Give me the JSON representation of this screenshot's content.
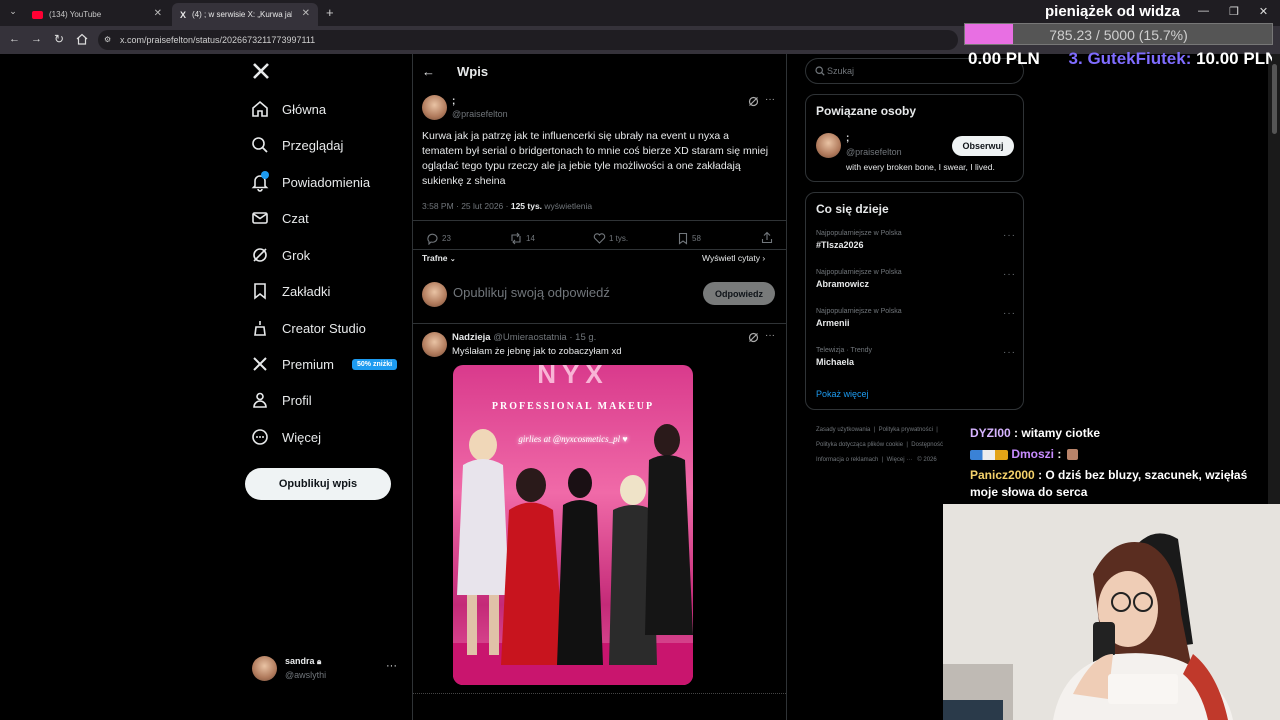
{
  "browser": {
    "tabs": [
      {
        "title": "(134) YouTube"
      },
      {
        "title": "(4) ; w serwisie X: „Kurwa jak ja"
      }
    ],
    "url": "x.com/praisefelton/status/2026673211773997111"
  },
  "sidebar": {
    "items": [
      {
        "label": "Główna",
        "icon": "home-icon"
      },
      {
        "label": "Przeglądaj",
        "icon": "search-icon"
      },
      {
        "label": "Powiadomienia",
        "icon": "bell-icon"
      },
      {
        "label": "Czat",
        "icon": "mail-icon"
      },
      {
        "label": "Grok",
        "icon": "grok-icon"
      },
      {
        "label": "Zakładki",
        "icon": "bookmark-icon"
      },
      {
        "label": "Creator Studio",
        "icon": "creator-icon"
      },
      {
        "label": "Premium",
        "icon": "x-logo-icon",
        "badge": "50% zniżki"
      },
      {
        "label": "Profil",
        "icon": "person-icon"
      },
      {
        "label": "Więcej",
        "icon": "more-circle-icon"
      }
    ],
    "post_button": "Opublikuj wpis",
    "account": {
      "name": "sandra",
      "handle": "@awslythi"
    }
  },
  "post": {
    "header_title": "Wpis",
    "author_name": ";",
    "author_handle": "@praisefelton",
    "text": "Kurwa jak ja patrzę jak te influencerki się ubrały na event u nyxa a tematem był serial o bridgertonach to mnie coś bierze XD staram się mniej oglądać tego typu rzeczy ale ja jebie tyle możliwości a one zakładają sukienkę z sheina",
    "time": "3:58 PM · 25 lut 2026 ·",
    "views_count": "125 tys.",
    "views_label": "wyświetlenia",
    "stats": {
      "replies": "23",
      "reposts": "14",
      "likes": "1 tys.",
      "bookmarks": "58"
    },
    "sort_label": "Trafne",
    "quotes_label": "Wyświetl cytaty",
    "reply_placeholder": "Opublikuj swoją odpowiedź",
    "reply_button": "Odpowiedz"
  },
  "reply": {
    "name": "Nadzieja",
    "handle": "@Umieraostatnia",
    "time": "· 15 g.",
    "text": "Myślałam że jebnę jak to zobaczyłam xd",
    "image_sign_top": "NYX",
    "image_sign_sub": "PROFESSIONAL MAKEUP",
    "image_neon": "girlies at @nyxcosmetics_pl ♥"
  },
  "right": {
    "search_placeholder": "Szukaj",
    "related_title": "Powiązane osoby",
    "related_name": ";",
    "related_handle": "@praisefelton",
    "related_bio": "with every broken bone, I swear, I lived.",
    "follow_label": "Obserwuj",
    "trends_title": "Co się dzieje",
    "trends": [
      {
        "category": "Najpopularniejsze w Polska",
        "name": "#TIsza2026"
      },
      {
        "category": "Najpopularniejsze w Polska",
        "name": "Abramowicz"
      },
      {
        "category": "Najpopularniejsze w Polska",
        "name": "Armenii"
      },
      {
        "category": "Telewizja · Trendy",
        "name": "Michaela"
      }
    ],
    "show_more": "Pokaż więcej",
    "footer": [
      "Zasady użytkowania",
      "Polityka prywatności",
      "Polityka dotycząca plików cookie",
      "Dostępność",
      "Informacja o reklamach",
      "Więcej ···",
      "© 2026"
    ]
  },
  "stream": {
    "donation_title": "pieniążek od widza",
    "progress_text": "785.23 / 5000 (15.7%)",
    "progress_fraction": 0.157,
    "ticker_amount_prev": "0.00 PLN",
    "ticker_donor": "3. GutekFiutek:",
    "ticker_amount": "10.00 PLN",
    "chat": [
      {
        "user": "DYZI00",
        "message": ": witamy ciotke",
        "color": "#d6b4ff"
      },
      {
        "user": "Dmoszi",
        "message": ":",
        "color": "#c88cff"
      },
      {
        "user": "Panicz2000",
        "message": ": O dziś bez bluzy, szacunek, wzięłaś moje słowa do serca",
        "color": "#f5d26b"
      }
    ]
  },
  "colors": {
    "accent": "#1d9bf0",
    "progress": "#e86fe3",
    "ticker_name": "#7f6cff",
    "ticker_amount": "#ffffff"
  }
}
